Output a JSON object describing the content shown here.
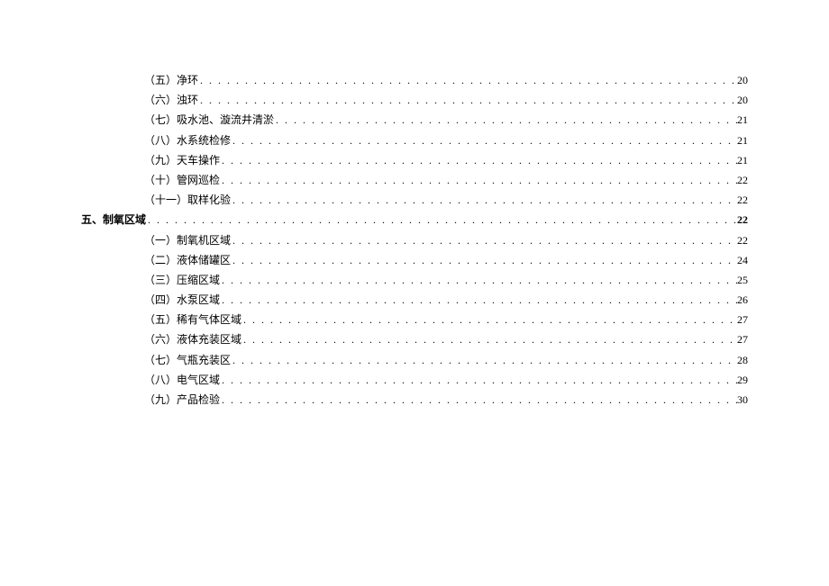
{
  "toc": [
    {
      "level": 2,
      "label": "（五）净环",
      "page": "20"
    },
    {
      "level": 2,
      "label": "（六）浊环",
      "page": "20"
    },
    {
      "level": 2,
      "label": "（七）吸水池、漩流井清淤",
      "page": "21"
    },
    {
      "level": 2,
      "label": "（八）水系统检修",
      "page": "21"
    },
    {
      "level": 2,
      "label": "（九）天车操作",
      "page": "21"
    },
    {
      "level": 2,
      "label": "（十）管网巡检",
      "page": "22"
    },
    {
      "level": 2,
      "label": "（十一）取样化验",
      "page": "22"
    },
    {
      "level": 1,
      "label": "五、制氧区域",
      "page": "22"
    },
    {
      "level": 2,
      "label": "（一）制氧机区域",
      "page": "22"
    },
    {
      "level": 2,
      "label": "（二）液体储罐区",
      "page": "24"
    },
    {
      "level": 2,
      "label": "（三）压缩区域",
      "page": "25"
    },
    {
      "level": 2,
      "label": "（四）水泵区域",
      "page": "26"
    },
    {
      "level": 2,
      "label": "（五）稀有气体区域",
      "page": "27"
    },
    {
      "level": 2,
      "label": "（六）液体充装区域",
      "page": "27"
    },
    {
      "level": 2,
      "label": "（七）气瓶充装区",
      "page": "28"
    },
    {
      "level": 2,
      "label": "（八）电气区域",
      "page": "29"
    },
    {
      "level": 2,
      "label": "（九）产品检验",
      "page": "30"
    }
  ]
}
